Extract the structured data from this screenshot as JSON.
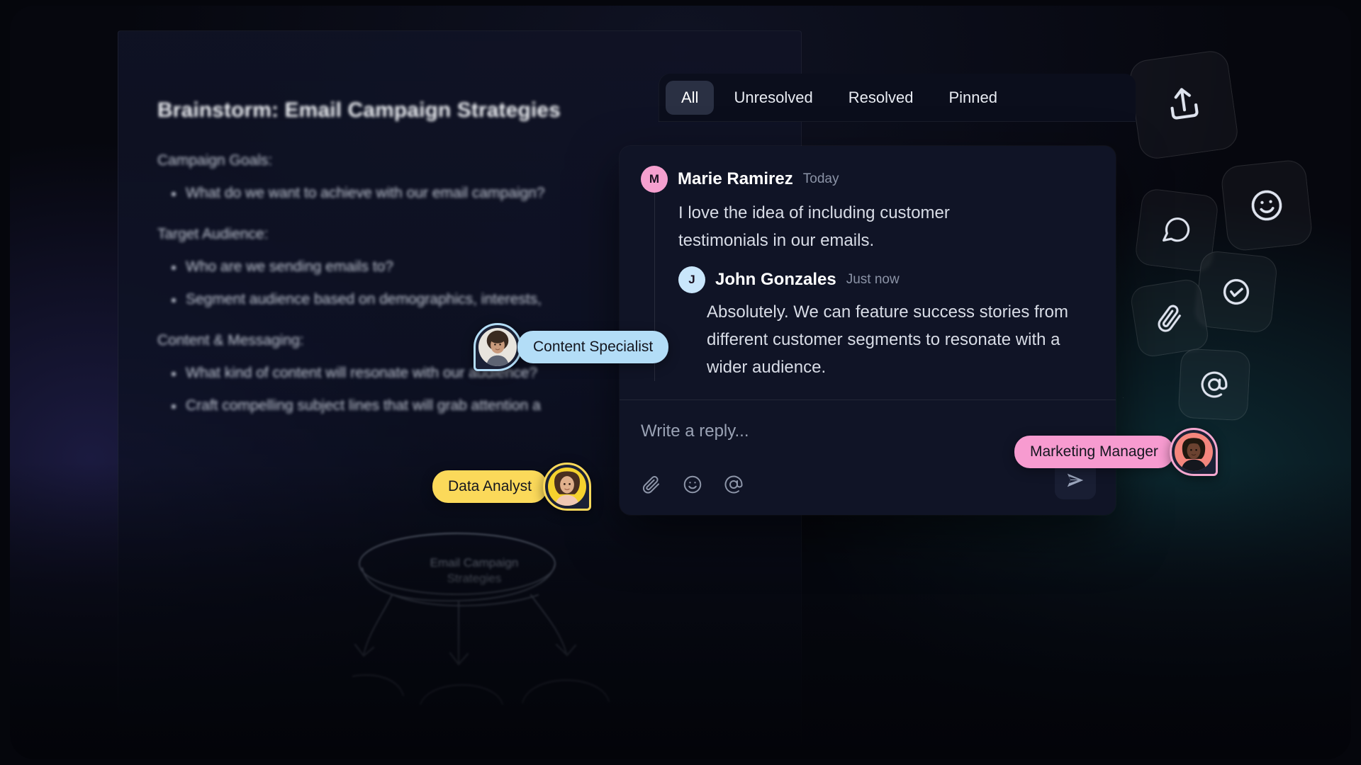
{
  "document": {
    "title": "Brainstorm: Email Campaign Strategies",
    "sections": [
      {
        "heading": "Campaign Goals:",
        "bullets": [
          "What do we want to achieve with our email campaign?"
        ]
      },
      {
        "heading": "Target Audience:",
        "bullets": [
          "Who are we sending emails to?",
          "Segment audience based on demographics, interests,"
        ]
      },
      {
        "heading": "Content & Messaging:",
        "bullets": [
          "What kind of content will resonate with our audience?",
          "Craft compelling subject lines that will grab attention a"
        ]
      }
    ],
    "mindmap": {
      "root_label": "Email Campaign\nStrategies",
      "branch_count": 3
    }
  },
  "filter_tabs": {
    "items": [
      {
        "label": "All",
        "active": true
      },
      {
        "label": "Unresolved",
        "active": false
      },
      {
        "label": "Resolved",
        "active": false
      },
      {
        "label": "Pinned",
        "active": false
      }
    ]
  },
  "comment_thread": {
    "root": {
      "avatar_initial": "M",
      "avatar_color": "#f5a0cf",
      "author": "Marie Ramirez",
      "timestamp": "Today",
      "text": "I love the idea of including customer testimonials in our emails."
    },
    "reply": {
      "avatar_initial": "J",
      "avatar_color": "#c9e6fb",
      "author": "John Gonzales",
      "timestamp": "Just now",
      "text": "Absolutely. We can feature success stories from different customer segments to resonate with a wider audience."
    }
  },
  "composer": {
    "value": "",
    "placeholder": "Write a reply...",
    "tools": [
      {
        "name": "attach-icon",
        "label": "Attach file"
      },
      {
        "name": "emoji-icon",
        "label": "Insert emoji"
      },
      {
        "name": "mention-icon",
        "label": "Mention someone"
      }
    ],
    "send_label": "Send"
  },
  "presence": [
    {
      "role_label": "Content Specialist",
      "badge_color": "#b3ddf7",
      "ring_color": "#b3ddf7",
      "side": "right"
    },
    {
      "role_label": "Data Analyst",
      "badge_color": "#fbd95a",
      "ring_color": "#fbd95a",
      "side": "left"
    },
    {
      "role_label": "Marketing Manager",
      "badge_color": "#f79bd0",
      "ring_color": "#f5a7cf",
      "side": "left"
    }
  ],
  "floating_tools": [
    {
      "name": "share-icon",
      "label": "Share"
    },
    {
      "name": "comment-icon",
      "label": "Comment"
    },
    {
      "name": "emoji-icon",
      "label": "React"
    },
    {
      "name": "check-icon",
      "label": "Resolve"
    },
    {
      "name": "attach-icon",
      "label": "Attach"
    },
    {
      "name": "mention-icon",
      "label": "Mention"
    }
  ],
  "theme": {
    "background": "#05060c",
    "panel": "#101426",
    "tabbar": "#0b0e1c",
    "active_tab": "#2a3043",
    "accent_pink": "#f5a0cf",
    "accent_blue": "#b3ddf7",
    "accent_yellow": "#fbd95a"
  }
}
